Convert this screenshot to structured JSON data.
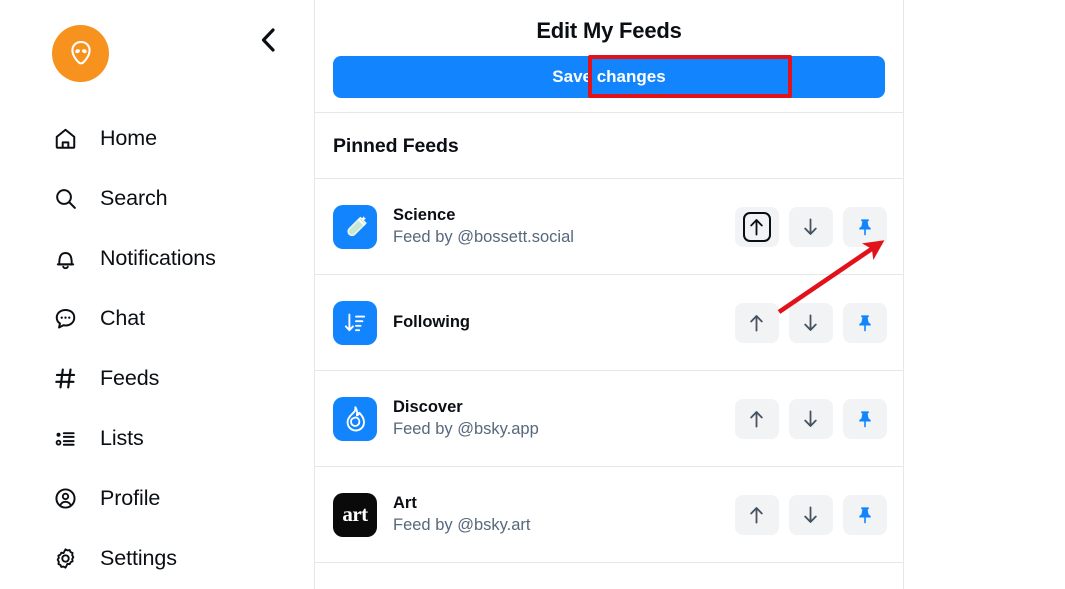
{
  "sidebar": {
    "avatar_icon": "alien-avatar-icon",
    "avatar_color": "#f7921e",
    "collapse_icon": "chevron-left-icon",
    "items": [
      {
        "label": "Home",
        "icon": "home-icon"
      },
      {
        "label": "Search",
        "icon": "search-icon"
      },
      {
        "label": "Notifications",
        "icon": "bell-icon"
      },
      {
        "label": "Chat",
        "icon": "chat-bubble-icon"
      },
      {
        "label": "Feeds",
        "icon": "hashtag-icon"
      },
      {
        "label": "Lists",
        "icon": "list-icon"
      },
      {
        "label": "Profile",
        "icon": "user-circle-icon"
      },
      {
        "label": "Settings",
        "icon": "gear-icon"
      }
    ]
  },
  "main": {
    "title": "Edit My Feeds",
    "save_label": "Save changes",
    "save_color": "#1285fe",
    "section_header": "Pinned Feeds",
    "feeds": [
      {
        "name": "Science",
        "byline": "Feed by @bossett.social",
        "avatar_icon": "test-tube-icon",
        "avatar_color": "#1285fe",
        "up_focused": true,
        "pinned": true
      },
      {
        "name": "Following",
        "byline": "",
        "avatar_icon": "sort-descending-icon",
        "avatar_color": "#1285fe",
        "up_focused": false,
        "pinned": true
      },
      {
        "name": "Discover",
        "byline": "Feed by @bsky.app",
        "avatar_icon": "flame-icon",
        "avatar_color": "#1285fe",
        "up_focused": false,
        "pinned": true
      },
      {
        "name": "Art",
        "byline": "Feed by @bsky.art",
        "avatar_icon": "art-text-icon",
        "avatar_label": "art",
        "avatar_color": "#0a0a0a",
        "up_focused": false,
        "pinned": true
      }
    ],
    "actions": {
      "move_up_icon": "arrow-up-icon",
      "move_down_icon": "arrow-down-icon",
      "pin_icon": "pin-icon",
      "pin_color": "#1285fe"
    }
  },
  "annotations": {
    "highlight_color": "#e1121a",
    "rect_target": "Save changes",
    "arrow_target": "move-up-button"
  }
}
